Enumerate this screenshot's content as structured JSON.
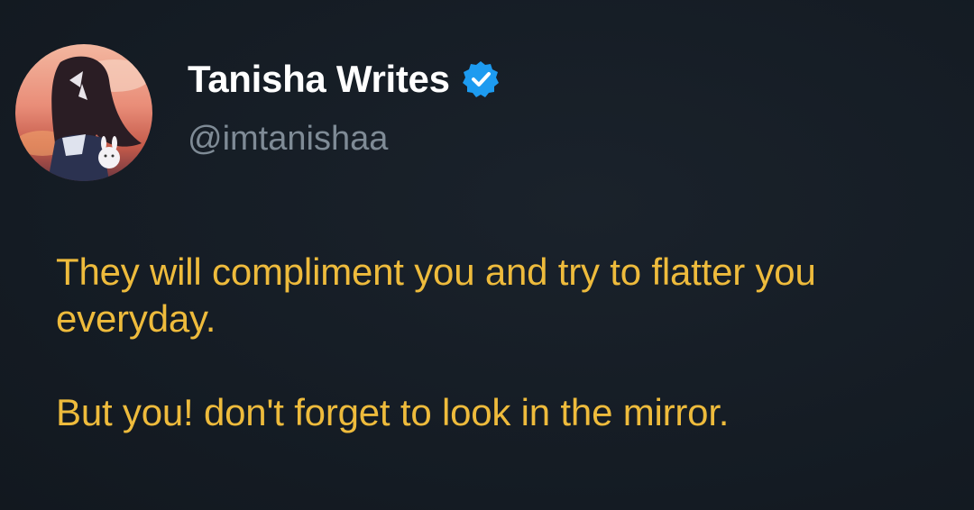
{
  "author": {
    "display_name": "Tanisha Writes",
    "handle": "@imtanishaa",
    "verified": true,
    "verified_icon": "verified-badge-icon",
    "verified_color": "#1d9bf0"
  },
  "tweet": {
    "paragraphs": [
      "They will compliment you and try to flatter you everyday.",
      "But you! don't forget to look in the mirror."
    ],
    "text_color": "#eebb3c"
  },
  "theme": {
    "background": "#151c24",
    "name_color": "#ffffff",
    "handle_color": "#7f8b96"
  }
}
